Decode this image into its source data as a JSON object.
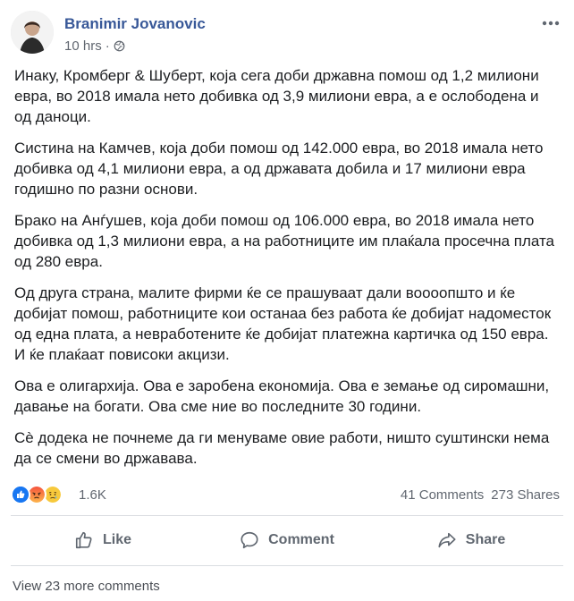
{
  "post": {
    "author": "Branimir Jovanovic",
    "time": "10 hrs",
    "dot": "·",
    "paragraphs": [
      "Инаку, Кромберг & Шуберт, која сега доби државна помош од 1,2 милиони евра, во 2018 имала нето добивка од 3,9 милиони евра, а е ослободена и од даноци.",
      "Систина на Камчев, која доби помош од 142.000 евра, во 2018 имала нето добивка од 4,1 милиони евра, а од државата добила и 17 милиони евра годишно по разни основи.",
      "Брако на Анѓушев, која доби помош од 106.000 евра, во 2018 имала нето добивка од 1,3 милиони евра, а на работниците им плаќала просечна плата од 280 евра.",
      "Од друга страна, малите фирми ќе се прашуваат дали воооопшто и ќе добијат помош, работниците кои останаа без работа ќе добијат надоместок од една плата, а невработените ќе добијат платежна картичка од 150 евра. И ќе плаќаат повисоки акцизи.",
      "Ова е олигархија. Ова е заробена економија. Ова е земање од сиромашни, давање на богати. Ова сме ние во последните 30 години.",
      "Сè додека не почнеме да ги менуваме овие работи, ништо суштински нема да се смени во државава."
    ]
  },
  "reactions": {
    "count": "1.6K",
    "types": [
      "like",
      "angry",
      "sad"
    ],
    "comments": "41 Comments",
    "shares": "273 Shares"
  },
  "actions": {
    "like": "Like",
    "comment": "Comment",
    "share": "Share"
  },
  "footer": {
    "view_more": "View 23 more comments"
  },
  "colors": {
    "author_link": "#385898",
    "secondary_text": "#616770",
    "like_blue": "#1877f2",
    "angry_orange": "#f5533d",
    "sad_yellow": "#f7c93c"
  }
}
